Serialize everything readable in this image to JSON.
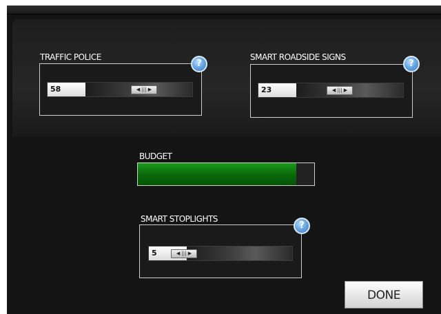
{
  "traffic_police": {
    "label": "TRAFFIC POLICE",
    "value": "58",
    "help_icon": "question-mark-icon"
  },
  "roadside_signs": {
    "label": "SMART ROADSIDE SIGNS",
    "value": "23",
    "help_icon": "question-mark-icon"
  },
  "budget": {
    "label": "BUDGET",
    "fill_fraction": 0.9,
    "fill_color": "#0a6a0a"
  },
  "stoplights": {
    "label": "SMART STOPLIGHTS",
    "value": "5",
    "help_icon": "question-mark-icon"
  },
  "help_glyph": "?",
  "slider_handle_glyph": "◀ ||| ▶",
  "done_label": "DONE",
  "colors": {
    "panel_border": "#cfcfcf",
    "help_blue": "#6aa9e6",
    "background": "#141414"
  }
}
